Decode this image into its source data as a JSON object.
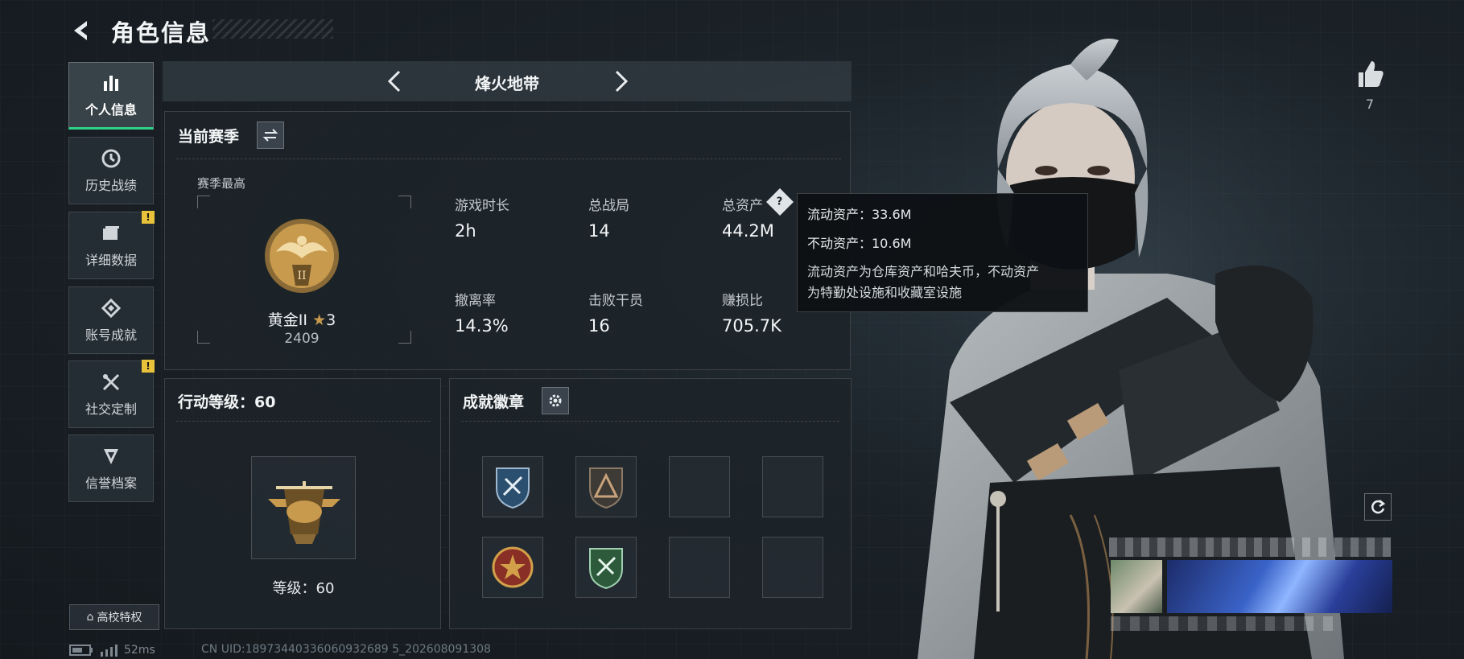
{
  "header": {
    "title": "角色信息"
  },
  "sidebar": {
    "items": [
      {
        "label": "个人信息",
        "active": true,
        "badge": ""
      },
      {
        "label": "历史战绩",
        "active": false,
        "badge": ""
      },
      {
        "label": "详细数据",
        "active": false,
        "badge": "!"
      },
      {
        "label": "账号成就",
        "active": false,
        "badge": ""
      },
      {
        "label": "社交定制",
        "active": false,
        "badge": "!"
      },
      {
        "label": "信誉档案",
        "active": false,
        "badge": ""
      }
    ],
    "campus_button": "高校特权"
  },
  "mode": {
    "title": "烽火地带"
  },
  "season": {
    "title": "当前赛季",
    "best_label": "赛季最高",
    "rank_name": "黄金II",
    "rank_stars": "3",
    "rank_score": "2409",
    "rank_emblem_numeral": "II",
    "stats": [
      {
        "label": "游戏时长",
        "value": "2h"
      },
      {
        "label": "总战局",
        "value": "14"
      },
      {
        "label": "总资产",
        "value": "44.2M"
      },
      {
        "label": "撤离率",
        "value": "14.3%"
      },
      {
        "label": "击败干员",
        "value": "16"
      },
      {
        "label": "赚损比",
        "value": "705.7K"
      }
    ],
    "help_icon_text": "?"
  },
  "tooltip": {
    "liquid": "流动资产：33.6M",
    "fixed": "不动资产：10.6M",
    "desc_line1": "流动资产为仓库资产和哈夫币，不动资产",
    "desc_line2": "为特勤处设施和收藏室设施"
  },
  "action_level": {
    "title": "行动等级：60",
    "level_text": "等级：60"
  },
  "achievements": {
    "title": "成就徽章"
  },
  "social": {
    "likes": "7"
  },
  "status": {
    "ping": "52ms",
    "uid": "CN UID:18973440336060932689 5_202608091308"
  },
  "colors": {
    "accent_green": "#2fd18a",
    "warn_yellow": "#e8c23a",
    "panel_bg": "#1c2329",
    "gold": "#c89a4e"
  }
}
